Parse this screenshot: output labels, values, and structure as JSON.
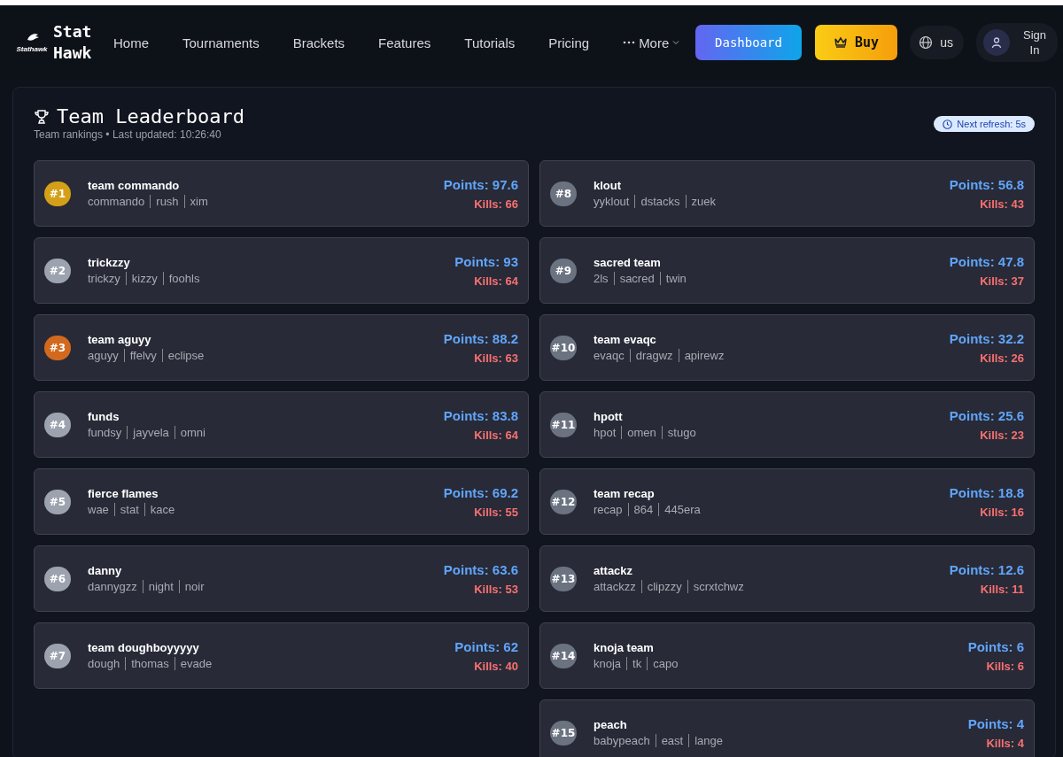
{
  "nav": {
    "brand": "Stat Hawk",
    "logo_text": "Stathawk",
    "links": [
      "Home",
      "Tournaments",
      "Brackets",
      "Features",
      "Tutorials",
      "Pricing"
    ],
    "more": "More",
    "dashboard": "Dashboard",
    "buy": "Buy",
    "locale": "us",
    "sign_in": "Sign In"
  },
  "leaderboard": {
    "title": "Team Leaderboard",
    "subtitle": "Team rankings • Last updated: 10:26:40",
    "refresh": "Next refresh: 5s",
    "columns": [
      [
        {
          "rank": "#1",
          "color": "#d4a017",
          "name": "team commando",
          "players": [
            "commando",
            "rush",
            "xim"
          ],
          "points": "Points: 97.6",
          "kills": "Kills: 66"
        },
        {
          "rank": "#2",
          "color": "#9ca3af",
          "name": "trickzzy",
          "players": [
            "trickzy",
            "kizzy",
            "foohls"
          ],
          "points": "Points: 93",
          "kills": "Kills: 64"
        },
        {
          "rank": "#3",
          "color": "#d2691e",
          "name": "team aguyy",
          "players": [
            "aguyy",
            "ffelvy",
            "eclipse"
          ],
          "points": "Points: 88.2",
          "kills": "Kills: 63"
        },
        {
          "rank": "#4",
          "color": "#9ca3af",
          "name": "funds",
          "players": [
            "fundsy",
            "jayvela",
            "omni"
          ],
          "points": "Points: 83.8",
          "kills": "Kills: 64"
        },
        {
          "rank": "#5",
          "color": "#9ca3af",
          "name": "fierce flames",
          "players": [
            "wae",
            "stat",
            "kace"
          ],
          "points": "Points: 69.2",
          "kills": "Kills: 55"
        },
        {
          "rank": "#6",
          "color": "#9ca3af",
          "name": "danny",
          "players": [
            "dannygzz",
            "night",
            "noir"
          ],
          "points": "Points: 63.6",
          "kills": "Kills: 53"
        },
        {
          "rank": "#7",
          "color": "#9ca3af",
          "name": "team doughboyyyyy",
          "players": [
            "dough",
            "thomas",
            "evade"
          ],
          "points": "Points: 62",
          "kills": "Kills: 40"
        }
      ],
      [
        {
          "rank": "#8",
          "color": "#6b7280",
          "name": "klout",
          "players": [
            "yyklout",
            "dstacks",
            "zuek"
          ],
          "points": "Points: 56.8",
          "kills": "Kills: 43"
        },
        {
          "rank": "#9",
          "color": "#6b7280",
          "name": "sacred team",
          "players": [
            "2ls",
            "sacred",
            "twin"
          ],
          "points": "Points: 47.8",
          "kills": "Kills: 37"
        },
        {
          "rank": "#10",
          "color": "#6b7280",
          "name": "team evaqc",
          "players": [
            "evaqc",
            "dragwz",
            "apirewz"
          ],
          "points": "Points: 32.2",
          "kills": "Kills: 26"
        },
        {
          "rank": "#11",
          "color": "#6b7280",
          "name": "hpott",
          "players": [
            "hpot",
            "omen",
            "stugo"
          ],
          "points": "Points: 25.6",
          "kills": "Kills: 23"
        },
        {
          "rank": "#12",
          "color": "#6b7280",
          "name": "team recap",
          "players": [
            "recap",
            "864",
            "445era"
          ],
          "points": "Points: 18.8",
          "kills": "Kills: 16"
        },
        {
          "rank": "#13",
          "color": "#6b7280",
          "name": "attackz",
          "players": [
            "attackzz",
            "clipzzy",
            "scrxtchwz"
          ],
          "points": "Points: 12.6",
          "kills": "Kills: 11"
        },
        {
          "rank": "#14",
          "color": "#6b7280",
          "name": "knoja team",
          "players": [
            "knoja",
            "tk",
            "capo"
          ],
          "points": "Points: 6",
          "kills": "Kills: 6"
        },
        {
          "rank": "#15",
          "color": "#6b7280",
          "name": "peach",
          "players": [
            "babypeach",
            "east",
            "lange"
          ],
          "points": "Points: 4",
          "kills": "Kills: 4"
        }
      ]
    ]
  }
}
